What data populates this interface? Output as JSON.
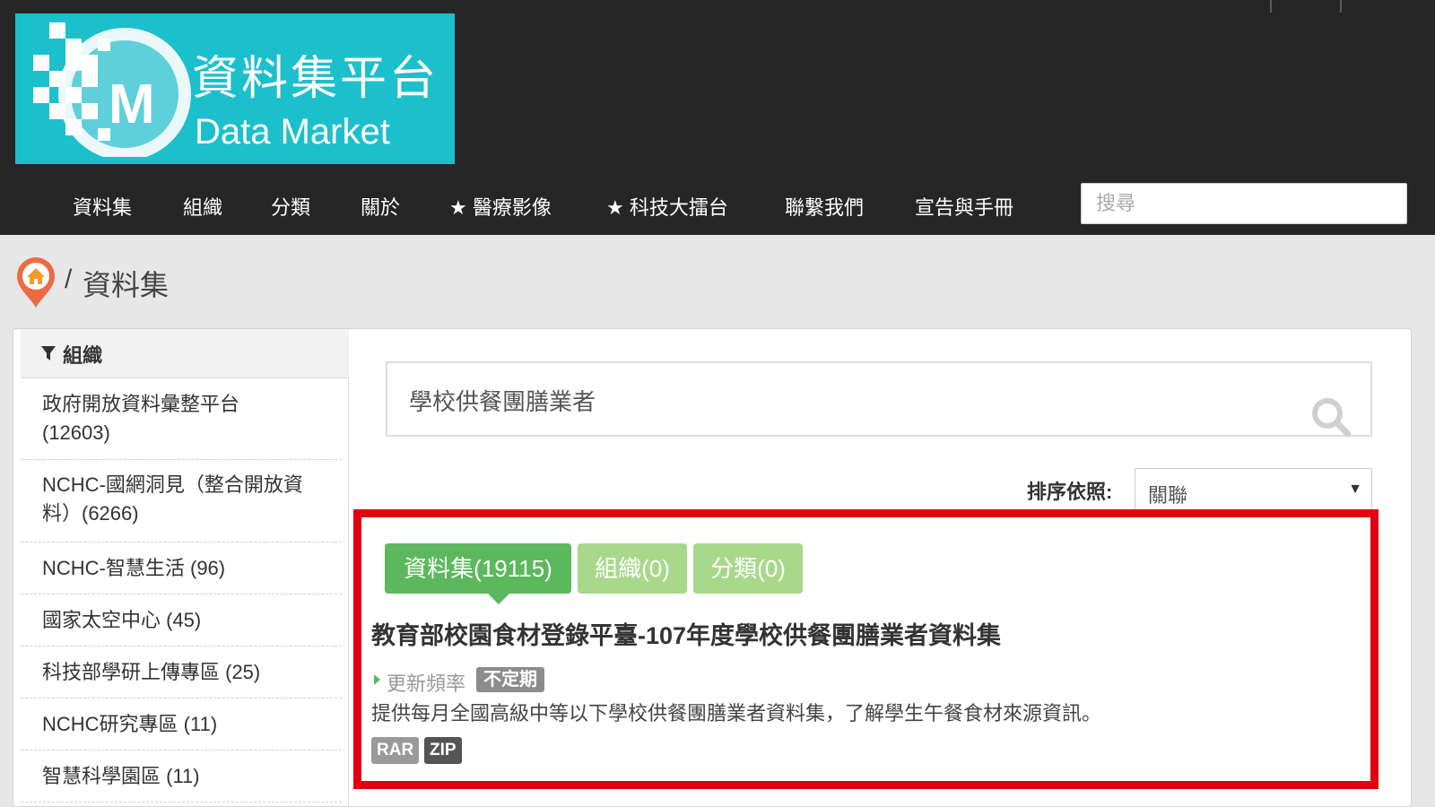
{
  "header": {
    "logo_cn": "資料集平台",
    "logo_en": "Data Market",
    "nav": [
      {
        "label": "資料集"
      },
      {
        "label": "組織"
      },
      {
        "label": "分類"
      },
      {
        "label": "關於"
      },
      {
        "label": "★ 醫療影像"
      },
      {
        "label": "★ 科技大擂台"
      },
      {
        "label": "聯繫我們"
      },
      {
        "label": "宣告與手冊"
      }
    ],
    "search_placeholder": "搜尋"
  },
  "breadcrumb": {
    "separator": "/",
    "current": "資料集"
  },
  "sidebar": {
    "facet_title": "組織",
    "items": [
      {
        "label_line1": "政府開放資料彙整平台",
        "label_line2": "(12603)"
      },
      {
        "label_line1": "NCHC-國網洞見（整合開放資",
        "label_line2": "料）(6266)"
      },
      {
        "label_line1": "NCHC-智慧生活 (96)"
      },
      {
        "label_line1": "國家太空中心 (45)"
      },
      {
        "label_line1": "科技部學研上傳專區 (25)"
      },
      {
        "label_line1": "NCHC研究專區 (11)"
      },
      {
        "label_line1": "智慧科學園區 (11)"
      }
    ]
  },
  "search": {
    "query": "學校供餐團膳業者"
  },
  "sort": {
    "label": "排序依照:",
    "selected": "關聯"
  },
  "tabs": [
    {
      "label": "資料集(19115)",
      "active": true
    },
    {
      "label": "組織(0)",
      "active": false
    },
    {
      "label": "分類(0)",
      "active": false
    }
  ],
  "result": {
    "title": "教育部校園食材登錄平臺-107年度學校供餐團膳業者資料集",
    "freq_label": "更新頻率",
    "freq_value": "不定期",
    "description": "提供每月全國高級中等以下學校供餐團膳業者資料集，了解學生午餐食材來源資訊。",
    "formats": [
      "RAR",
      "ZIP"
    ]
  },
  "colors": {
    "header_bg": "#262626",
    "logo_bg": "#1cc0cc",
    "tab_active": "#5cb85c",
    "tab_inactive": "#a8d98a",
    "highlight_border": "#e3000f"
  },
  "icons": {
    "home": "home-pin-icon",
    "filter": "filter-icon",
    "search": "search-icon",
    "dropdown": "caret-down-icon"
  }
}
